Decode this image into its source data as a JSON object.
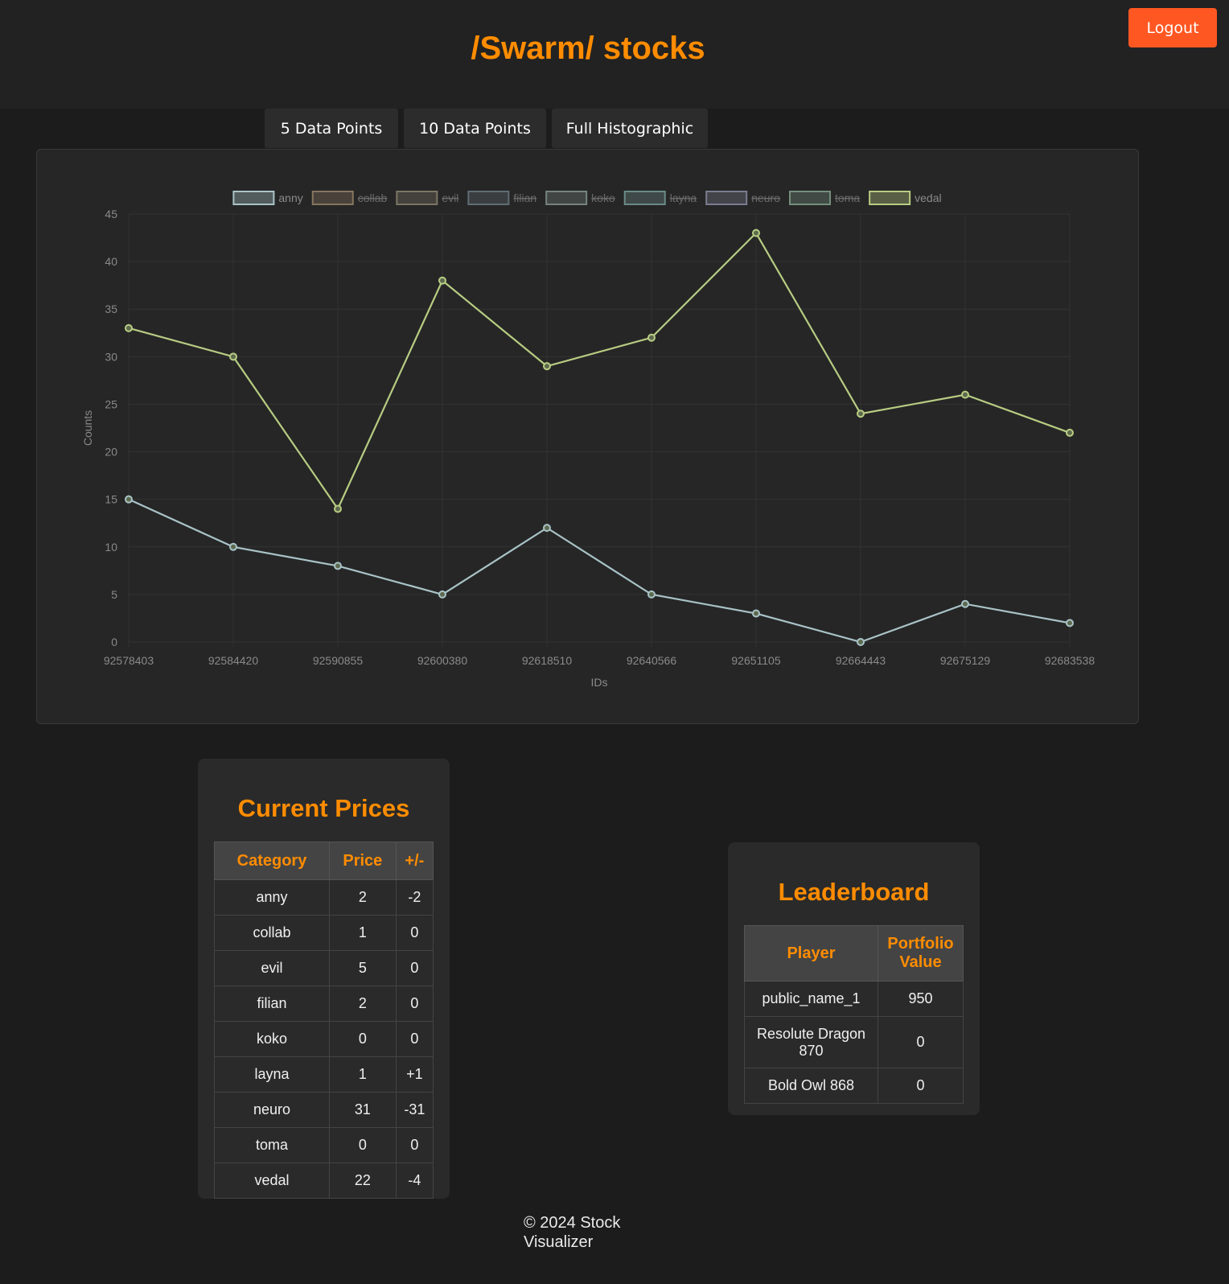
{
  "header": {
    "title": "/Swarm/ stocks",
    "logout_label": "Logout"
  },
  "range_buttons": {
    "five": "5 Data Points",
    "ten": "10 Data Points",
    "full": "Full Histographic"
  },
  "chart_data": {
    "type": "line",
    "x": [
      "92578403",
      "92584420",
      "92590855",
      "92600380",
      "92618510",
      "92640566",
      "92651105",
      "92664443",
      "92675129",
      "92683538"
    ],
    "xlabel": "IDs",
    "ylabel": "Counts",
    "ylim": [
      0,
      45
    ],
    "yticks": [
      0,
      5,
      10,
      15,
      20,
      25,
      30,
      35,
      40,
      45
    ],
    "grid": true,
    "legend_position": "top-center",
    "legend": [
      {
        "name": "anny",
        "color": "#a9c3c7",
        "hidden": false
      },
      {
        "name": "collab",
        "color": "#d6b98e",
        "hidden": true
      },
      {
        "name": "evil",
        "color": "#c2b89a",
        "hidden": true
      },
      {
        "name": "filian",
        "color": "#8fa6b2",
        "hidden": true
      },
      {
        "name": "koko",
        "color": "#b6cfc7",
        "hidden": true
      },
      {
        "name": "layna",
        "color": "#a3dcd7",
        "hidden": true
      },
      {
        "name": "neuro",
        "color": "#bfc3e6",
        "hidden": true
      },
      {
        "name": "toma",
        "color": "#b4e6c5",
        "hidden": true
      },
      {
        "name": "vedal",
        "color": "#b7cc82",
        "hidden": false
      }
    ],
    "series": [
      {
        "name": "anny",
        "color": "#a9c3c7",
        "values": [
          15,
          10,
          8,
          5,
          12,
          5,
          3,
          0,
          4,
          2
        ]
      },
      {
        "name": "vedal",
        "color": "#b7cc82",
        "values": [
          33,
          30,
          14,
          38,
          29,
          32,
          43,
          24,
          26,
          22
        ]
      }
    ]
  },
  "prices": {
    "title": "Current Prices",
    "headers": [
      "Category",
      "Price",
      "+/-"
    ],
    "rows": [
      [
        "anny",
        "2",
        "-2"
      ],
      [
        "collab",
        "1",
        "0"
      ],
      [
        "evil",
        "5",
        "0"
      ],
      [
        "filian",
        "2",
        "0"
      ],
      [
        "koko",
        "0",
        "0"
      ],
      [
        "layna",
        "1",
        "+1"
      ],
      [
        "neuro",
        "31",
        "-31"
      ],
      [
        "toma",
        "0",
        "0"
      ],
      [
        "vedal",
        "22",
        "-4"
      ]
    ]
  },
  "leaderboard": {
    "title": "Leaderboard",
    "headers": [
      "Player",
      "Portfolio Value"
    ],
    "rows": [
      [
        "public_name_1",
        "950"
      ],
      [
        "Resolute Dragon 870",
        "0"
      ],
      [
        "Bold Owl 868",
        "0"
      ]
    ]
  },
  "footer": {
    "text": "© 2024 Stock Visualizer"
  }
}
